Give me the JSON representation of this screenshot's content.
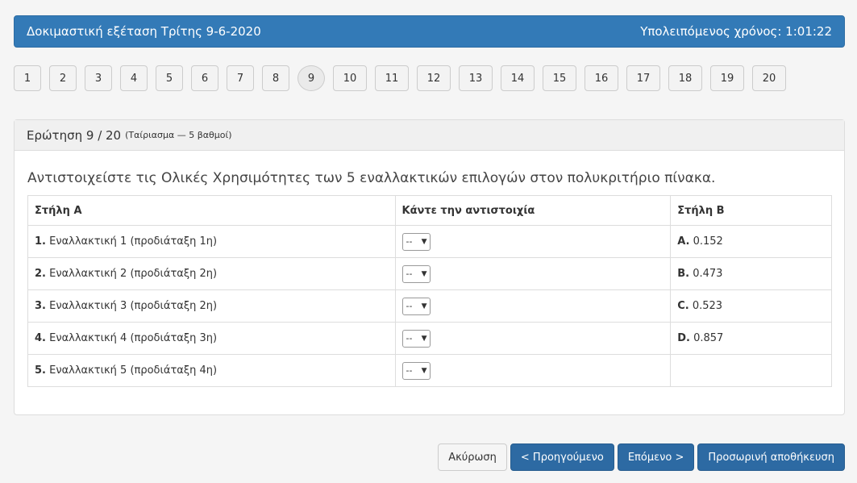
{
  "header": {
    "exam_title": "Δοκιμαστική εξέταση Τρίτης 9-6-2020",
    "time_label": "Υπολειπόμενος χρόνος:",
    "time_value": "1:01:22"
  },
  "question_nav": [
    {
      "label": "1"
    },
    {
      "label": "2"
    },
    {
      "label": "3"
    },
    {
      "label": "4"
    },
    {
      "label": "5"
    },
    {
      "label": "6"
    },
    {
      "label": "7"
    },
    {
      "label": "8"
    },
    {
      "label": "9",
      "current": true
    },
    {
      "label": "10"
    },
    {
      "label": "11"
    },
    {
      "label": "12"
    },
    {
      "label": "13"
    },
    {
      "label": "14"
    },
    {
      "label": "15"
    },
    {
      "label": "16"
    },
    {
      "label": "17"
    },
    {
      "label": "18"
    },
    {
      "label": "19"
    },
    {
      "label": "20"
    }
  ],
  "question": {
    "heading": "Ερώτηση 9 / 20",
    "heading_sub": "(Ταίριασμα — 5 βαθμοί)",
    "text": "Αντιστοιχείστε τις Ολικές Χρησιμότητες των 5 εναλλακτικών επιλογών στον πολυκριτήριο πίνακα.",
    "table": {
      "col_a": "Στήλη Α",
      "col_match": "Κάντε την αντιστοιχία",
      "col_b": "Στήλη Β",
      "rows": [
        {
          "a_num": "1.",
          "a_text": "Εναλλακτική 1 (προδιάταξη 1η)",
          "select": "--",
          "b_key": "A.",
          "b_val": "0.152"
        },
        {
          "a_num": "2.",
          "a_text": "Εναλλακτική 2 (προδιάταξη 2η)",
          "select": "--",
          "b_key": "B.",
          "b_val": "0.473"
        },
        {
          "a_num": "3.",
          "a_text": "Εναλλακτική 3 (προδιάταξη 2η)",
          "select": "--",
          "b_key": "C.",
          "b_val": "0.523"
        },
        {
          "a_num": "4.",
          "a_text": "Εναλλακτική 4 (προδιάταξη 3η)",
          "select": "--",
          "b_key": "D.",
          "b_val": "0.857"
        },
        {
          "a_num": "5.",
          "a_text": "Εναλλακτική 5 (προδιάταξη 4η)",
          "select": "--",
          "b_key": "",
          "b_val": ""
        }
      ]
    }
  },
  "footer": {
    "cancel": "Ακύρωση",
    "previous": "< Προηγούμενο",
    "next": "Επόμενο >",
    "save": "Προσωρινή αποθήκευση"
  },
  "colors": {
    "primary": "#337ab7",
    "primary_dark": "#2d6aa3"
  }
}
